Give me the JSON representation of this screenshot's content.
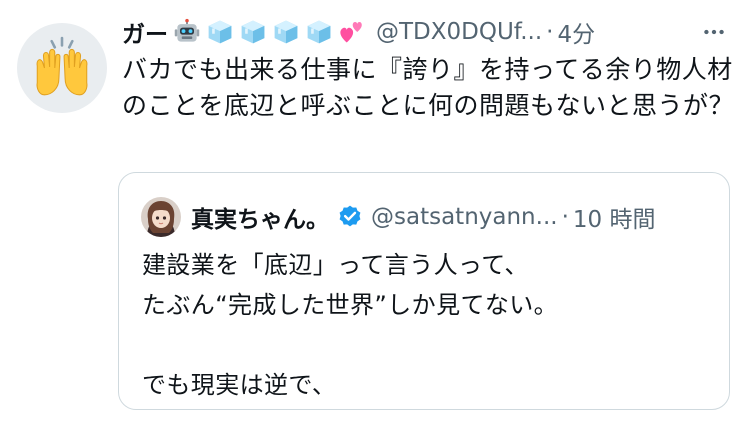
{
  "tweet": {
    "author": {
      "display_name": "ガー",
      "handle": "@TDX0DQUf...",
      "avatar_icon": "raising-hands-emoji",
      "name_emojis": [
        "robot-emoji",
        "ice-cube-emoji",
        "ice-cube-emoji",
        "ice-cube-emoji",
        "ice-cube-emoji",
        "two-hearts-emoji"
      ]
    },
    "separator": "·",
    "time": "4分",
    "more_icon": "ellipsis-icon",
    "text": "バカでも出来る仕事に『誇り』を持ってる余り物人材のことを底辺と呼ぶことに何の問題もないと思うが？"
  },
  "quoted_tweet": {
    "author": {
      "display_name": "真実ちゃん。",
      "handle": "@satsatnyann...",
      "verified": true,
      "verified_icon": "verified-badge-icon"
    },
    "separator": "·",
    "time": "10 時間",
    "lines": [
      "建設業を「底辺」って言う人って、",
      "たぶん“完成した世界”しか見てない。",
      "",
      "でも現実は逆で、"
    ]
  },
  "colors": {
    "text_primary": "#0f1419",
    "text_secondary": "#536471",
    "border": "#cfd9de",
    "verified_blue": "#1d9bf0"
  }
}
